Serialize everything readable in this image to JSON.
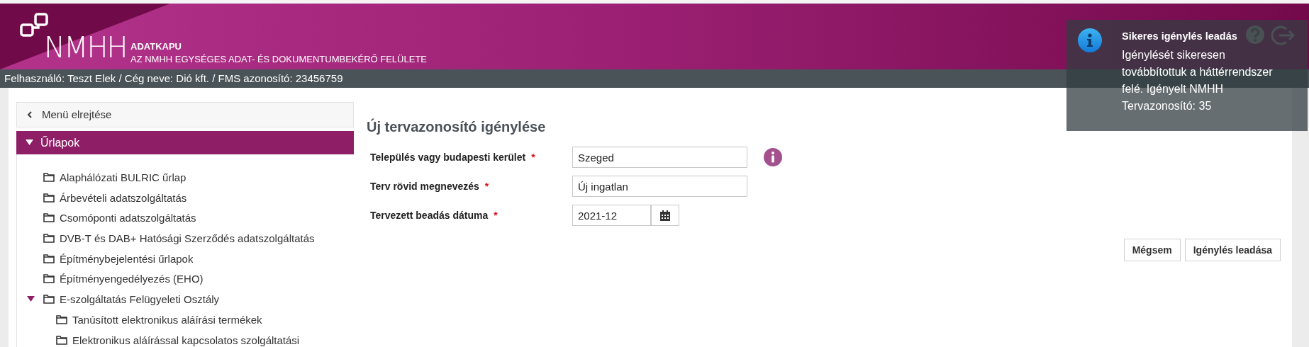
{
  "header": {
    "logo_text": "NMHH",
    "app_name": "ADATKAPU",
    "app_subtitle": "AZ NMHH EGYSÉGES ADAT- ÉS DOKUMENTUMBEKÉRŐ FELÜLETE"
  },
  "user_bar": "Felhasználó: Teszt Elek / Cég neve: Dió kft. / FMS azonosító: 23456759",
  "sidebar": {
    "hide_menu": "Menü elrejtése",
    "section": {
      "label": "Űrlapok",
      "expanded": true
    },
    "items": [
      {
        "label": "Alaphálózati BULRIC űrlap"
      },
      {
        "label": "Árbevételi adatszolgáltatás"
      },
      {
        "label": "Csomóponti adatszolgáltatás"
      },
      {
        "label": "DVB-T és DAB+ Hatósági Szerződés adatszolgáltatás"
      },
      {
        "label": "Építménybejelentési űrlapok"
      },
      {
        "label": "Építményengedélyezés (EHO)"
      },
      {
        "label": "E-szolgáltatás Felügyeleti Osztály",
        "expanded": true,
        "children": [
          {
            "label": "Tanúsított elektronikus aláírási termékek"
          },
          {
            "label": "Elektronikus aláírással kapcsolatos szolgáltatási"
          }
        ]
      }
    ]
  },
  "form": {
    "title": "Új tervazonosító igénylése",
    "fields": [
      {
        "kind": "text",
        "label": "Település vagy budapesti kerület",
        "required": true,
        "value": "Szeged",
        "info": true
      },
      {
        "kind": "text",
        "label": "Terv rövid megnevezés",
        "required": true,
        "value": "Új ingatlan",
        "info": false
      },
      {
        "kind": "date",
        "label": "Tervezett beadás dátuma",
        "required": true,
        "value": "2021-12",
        "info": false
      }
    ],
    "required_mark": "*",
    "buttons": [
      "Mégsem",
      "Igénylés leadása"
    ]
  },
  "toast": {
    "title": "Sikeres igénylés leadás",
    "message": "Igénylését sikeresen továbbítottuk a háttérrendszer felé. Igényelt NMHH Tervazonosító: 35"
  }
}
